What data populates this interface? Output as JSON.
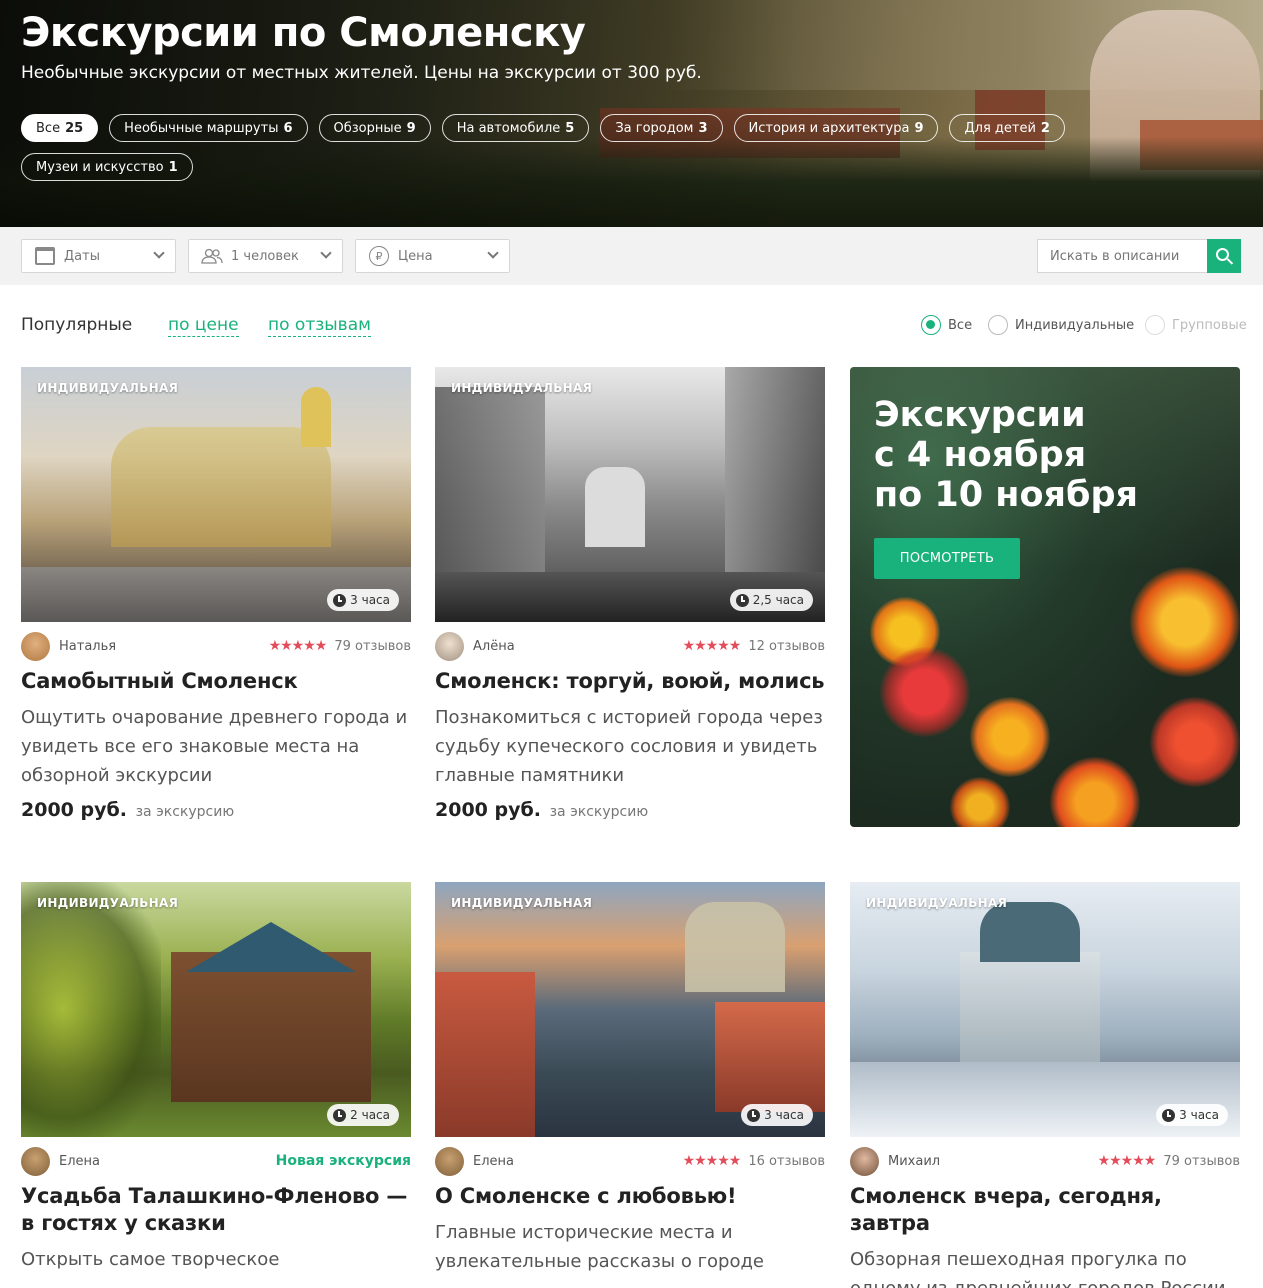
{
  "hero": {
    "title": "Экскурсии по Смоленску",
    "subtitle": "Необычные экскурсии от местных жителей. Цены на экскурсии от 300 руб.",
    "categories": [
      {
        "label": "Все",
        "count": "25",
        "active": true
      },
      {
        "label": "Необычные маршруты",
        "count": "6"
      },
      {
        "label": "Обзорные",
        "count": "9"
      },
      {
        "label": "На автомобиле",
        "count": "5"
      },
      {
        "label": "За городом",
        "count": "3"
      },
      {
        "label": "История и архитектура",
        "count": "9"
      },
      {
        "label": "Для детей",
        "count": "2"
      },
      {
        "label": "Музеи и искусство",
        "count": "1"
      }
    ]
  },
  "filters": {
    "dates": "Даты",
    "people": "1 человек",
    "price": "Цена",
    "price_icon": "₽",
    "search_placeholder": "Искать в описании"
  },
  "sort": {
    "popular": "Популярные",
    "by_price": "по цене",
    "by_reviews": "по отзывам"
  },
  "type_filter": {
    "all": "Все",
    "individual": "Индивидуальные",
    "group": "Групповые",
    "selected": "all"
  },
  "promo": {
    "title": "Экскурсии\nс 4 ноября\nпо 10 ноября",
    "button": "ПОСМОТРЕТЬ"
  },
  "tours": [
    {
      "badge": "ИНДИВИДУАЛЬНАЯ",
      "duration": "3 часа",
      "guide": "Наталья",
      "stars": "★★★★★",
      "reviews": "79 отзывов",
      "title": "Самобытный Смоленск",
      "desc": "Ощутить очарование древнего города и увидеть все его знаковые места на обзорной экскурсии",
      "price": "2000 руб.",
      "price_unit": "за экскурсию"
    },
    {
      "badge": "ИНДИВИДУАЛЬНАЯ",
      "duration": "2,5 часа",
      "guide": "Алёна",
      "stars": "★★★★★",
      "reviews": "12 отзывов",
      "title": "Смоленск: торгуй, воюй, молись",
      "desc": "Познакомиться с историей города через судьбу купеческого сословия и увидеть главные памятники",
      "price": "2000 руб.",
      "price_unit": "за экскурсию"
    },
    {
      "badge": "ИНДИВИДУАЛЬНАЯ",
      "duration": "2 часа",
      "guide": "Елена",
      "new_label": "Новая экскурсия",
      "title": "Усадьба Талашкино-Фленово — в гостях у сказки",
      "desc": "Открыть самое творческое"
    },
    {
      "badge": "ИНДИВИДУАЛЬНАЯ",
      "duration": "3 часа",
      "guide": "Елена",
      "stars": "★★★★★",
      "reviews": "16 отзывов",
      "title": "О Смоленске с любовью!",
      "desc": "Главные исторические места и увлекательные рассказы о городе"
    },
    {
      "badge": "ИНДИВИДУАЛЬНАЯ",
      "duration": "3 часа",
      "guide": "Михаил",
      "stars": "★★★★★",
      "reviews": "79 отзывов",
      "title": "Смоленск вчера, сегодня, завтра",
      "desc": "Обзорная пешеходная прогулка по одному из древнейших городов России"
    }
  ],
  "colors": {
    "accent": "#1ab27c",
    "stars": "#e34c5a"
  }
}
